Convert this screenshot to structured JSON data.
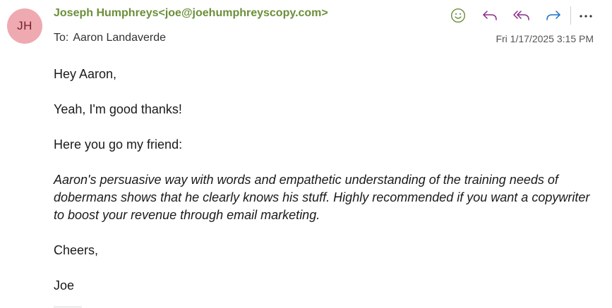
{
  "message": {
    "avatar_initials": "JH",
    "sender": "Joseph Humphreys<joe@joehumphreyscopy.com>",
    "to_label": "To:",
    "to_name": "Aaron Landaverde",
    "date": "Fri 1/17/2025 3:15 PM"
  },
  "actions": {
    "react_icon": "smiley-icon",
    "reply_icon": "reply-icon",
    "reply_all_icon": "reply-all-icon",
    "forward_icon": "forward-icon",
    "more_icon": "more-icon",
    "more_label": "···"
  },
  "body": {
    "greeting": "Hey Aaron,",
    "line1": "Yeah, I'm good thanks!",
    "line2": "Here you go my friend:",
    "quote": "Aaron's persuasive way with words and empathetic understanding of the training needs of dobermans shows that he clearly knows his stuff. Highly recommended if you want a copywriter to boost your revenue through email marketing.",
    "signoff": "Cheers,",
    "signature": "Joe"
  },
  "colors": {
    "sender": "#6b8f3a",
    "avatar_bg": "#eeaab0",
    "avatar_text": "#7a1c2a",
    "react_icon": "#6b8f3a",
    "reply_icons": "#8a2a8a",
    "forward_icon": "#1a6fc4"
  }
}
